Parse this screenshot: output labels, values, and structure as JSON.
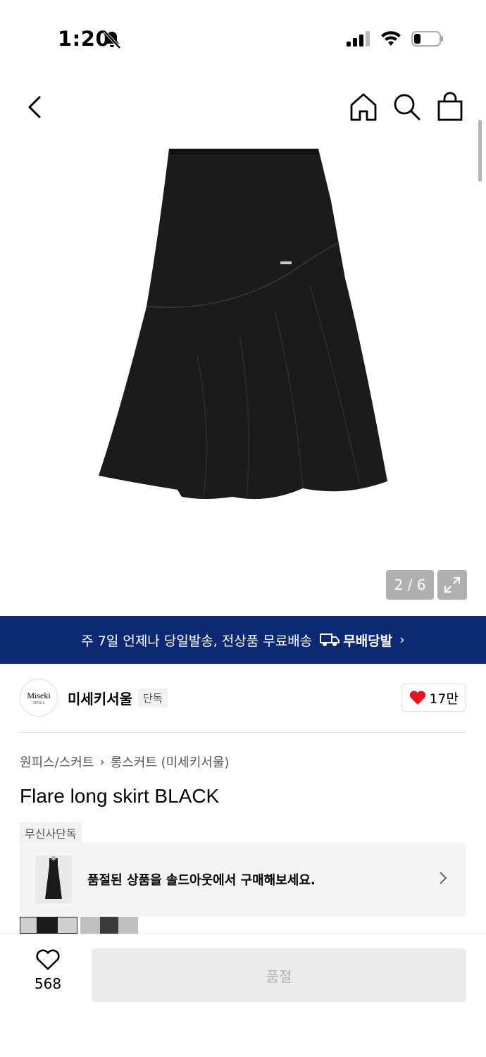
{
  "status_bar": {
    "time": "1:20"
  },
  "gallery": {
    "counter": "2 / 6"
  },
  "promo": {
    "text": "주 7일 언제나 당일발송, 전상품 무료배송",
    "badge": "무배당발",
    "chevron": "›"
  },
  "brand": {
    "logo_line1": "Miseki",
    "logo_line2": "SEOUL",
    "name": "미세키서울",
    "tag": "단독",
    "likes": "17만"
  },
  "breadcrumb": {
    "category": "원피스/스커트",
    "separator": "›",
    "subcategory": "롱스커트 (미세키서울)"
  },
  "product": {
    "title": "Flare long skirt BLACK",
    "tag": "무신사단독"
  },
  "soldout": {
    "text": "품절된 상품을 솔드아웃에서 구매해보세요."
  },
  "bottom_bar": {
    "wish_count": "568",
    "buy_label": "품절"
  },
  "colors": {
    "promo_bg": "#0c2a74",
    "heart_red": "#e8131d"
  },
  "icons": [
    "back-icon",
    "home-icon",
    "search-icon",
    "bag-icon",
    "expand-icon",
    "heart-icon",
    "chevron-right-icon",
    "bell-off-icon",
    "signal-icon",
    "wifi-icon",
    "battery-icon"
  ]
}
